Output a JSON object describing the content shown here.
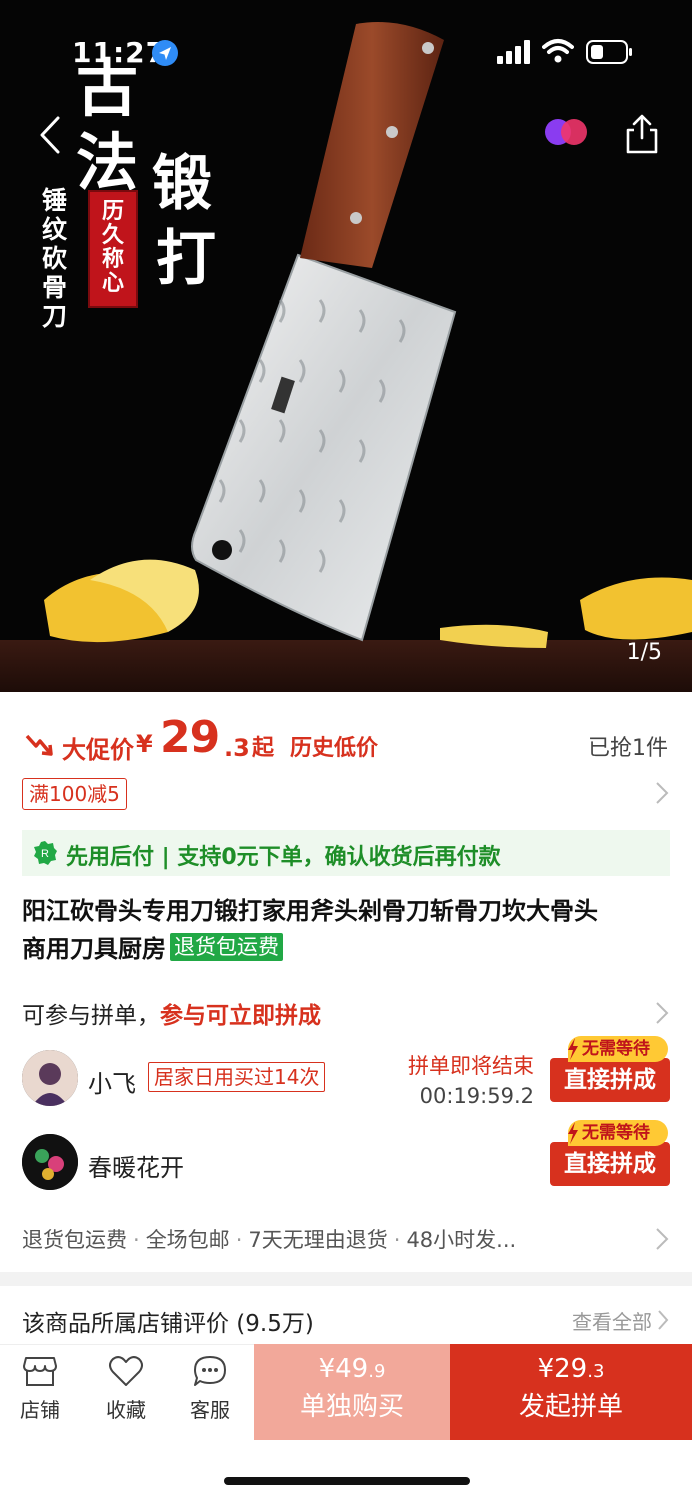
{
  "status_bar": {
    "time": "11:27"
  },
  "hero": {
    "title_chars": [
      "古",
      "法",
      "锻",
      "打"
    ],
    "side_text": "锤纹砍骨刀",
    "seal_chars": [
      "历",
      "久",
      "称",
      "心"
    ],
    "image_index": "1/5"
  },
  "price": {
    "promo_label": "大促价",
    "currency": "¥",
    "integer": "29",
    "decimal": ".3",
    "suffix": "起",
    "history_tag": "历史低价",
    "sold": "已抢1件"
  },
  "coupon": {
    "label": "满100减5"
  },
  "pay_later": {
    "text": "先用后付 | 支持0元下单，确认收货后再付款"
  },
  "product": {
    "title_line1": "阳江砍骨头专用刀锻打家用斧头剁骨刀斩骨刀坎大骨头",
    "title_line2": "商用刀具厨房",
    "tag": "退货包运费"
  },
  "group_buy": {
    "intro": "可参与拼单，",
    "intro_highlight": "参与可立即拼成",
    "groups": [
      {
        "name": "小飞",
        "tag": "居家日用买过14次",
        "status": "拼单即将结束",
        "timer": "00:19:59.2",
        "badge": "无需等待",
        "button": "直接拼成"
      },
      {
        "name": "春暖花开",
        "badge": "无需等待",
        "button": "直接拼成"
      }
    ]
  },
  "services": {
    "items": [
      "退货包运费",
      "全场包邮",
      "7天无理由退货",
      "48小时发..."
    ]
  },
  "reviews": {
    "title": "该商品所属店铺评价 (9.5万)",
    "view_all": "查看全部"
  },
  "bottom_bar": {
    "shop_label": "店铺",
    "fav_label": "收藏",
    "service_label": "客服",
    "solo_price_int": "¥49",
    "solo_price_dec": ".9",
    "solo_label": "单独购买",
    "group_price_int": "¥29",
    "group_price_dec": ".3",
    "group_label": "发起拼单"
  },
  "colors": {
    "accent": "#d7311e",
    "green": "#1e8e28",
    "solo_button": "#f2a89a",
    "badge_yellow": "#ffc934"
  }
}
